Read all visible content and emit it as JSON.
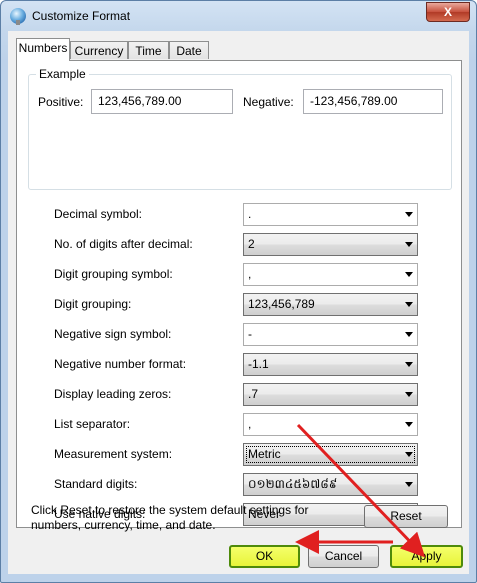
{
  "window": {
    "title": "Customize Format",
    "close_label": "X"
  },
  "tabs": [
    {
      "label": "Numbers",
      "active": true
    },
    {
      "label": "Currency",
      "active": false
    },
    {
      "label": "Time",
      "active": false
    },
    {
      "label": "Date",
      "active": false
    }
  ],
  "example": {
    "group_label": "Example",
    "positive_label": "Positive:",
    "positive_value": "123,456,789.00",
    "negative_label": "Negative:",
    "negative_value": "-123,456,789.00"
  },
  "settings": [
    {
      "label": "Decimal symbol:",
      "value": ".",
      "editable": true
    },
    {
      "label": "No. of digits after decimal:",
      "value": "2",
      "editable": false
    },
    {
      "label": "Digit grouping symbol:",
      "value": ",",
      "editable": true
    },
    {
      "label": "Digit grouping:",
      "value": "123,456,789",
      "editable": false
    },
    {
      "label": "Negative sign symbol:",
      "value": "-",
      "editable": true
    },
    {
      "label": "Negative number format:",
      "value": "-1.1",
      "editable": false
    },
    {
      "label": "Display leading zeros:",
      "value": ".7",
      "editable": false
    },
    {
      "label": "List separator:",
      "value": ",",
      "editable": true
    },
    {
      "label": "Measurement system:",
      "value": "Metric",
      "editable": false,
      "focused": true
    },
    {
      "label": "Standard digits:",
      "value": "០១២៣៤៥៦៧៨៩",
      "editable": false
    },
    {
      "label": "Use native digits:",
      "value": "Never",
      "editable": false
    }
  ],
  "footer": {
    "info_text": "Click Reset to restore the system default settings for numbers, currency, time, and date.",
    "reset_label": "Reset"
  },
  "buttons": {
    "ok": "OK",
    "cancel": "Cancel",
    "apply": "Apply"
  },
  "colors": {
    "annotation_arrow": "#e02020",
    "highlight": "#f0ff50"
  }
}
